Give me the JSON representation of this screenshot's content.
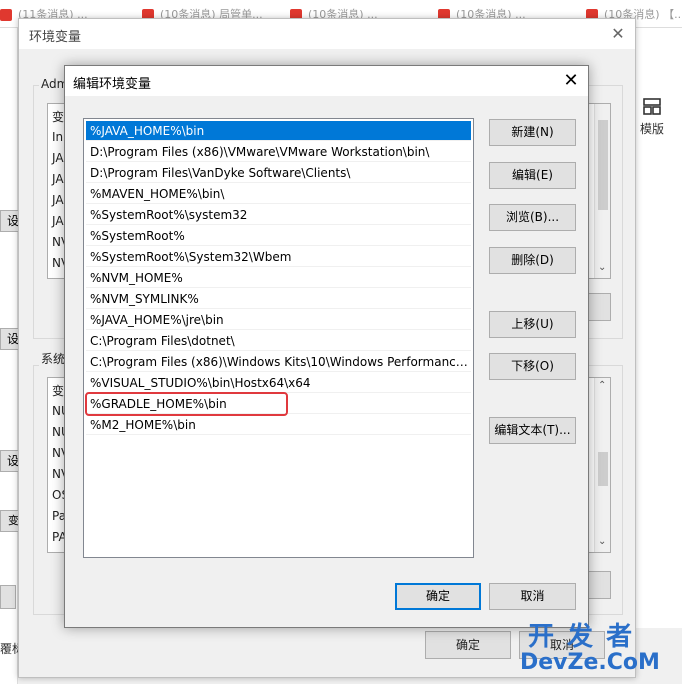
{
  "browser_tabs": [
    {
      "label": "(11条消息) ..."
    },
    {
      "label": "(10条消息) 局管单..."
    },
    {
      "label": "(10条消息) ..."
    },
    {
      "label": "(10条消息) ..."
    },
    {
      "label": "(10条消息) 【..."
    }
  ],
  "env_window": {
    "title": "环境变量",
    "user_group_label": "Adm",
    "user_list_header": "变",
    "user_list_items": [
      "In",
      "JA",
      "JA",
      "JA",
      "JA",
      "NV",
      "NV"
    ],
    "system_group_label": "系统",
    "system_list_header": "变",
    "system_list_items": [
      "NU",
      "NU",
      "NV",
      "NV",
      "OS",
      "Pa",
      "PA"
    ],
    "left_buttons": [
      "设",
      "设",
      "设",
      "变量"
    ],
    "bottom_left_text": "覆标",
    "ok_label": "确定",
    "cancel_label": "取消",
    "template_label": "模版"
  },
  "dialog": {
    "title": "编辑环境变量",
    "paths": [
      "%JAVA_HOME%\\bin",
      "D:\\Program Files (x86)\\VMware\\VMware Workstation\\bin\\",
      "D:\\Program Files\\VanDyke Software\\Clients\\",
      "%MAVEN_HOME%\\bin\\",
      "%SystemRoot%\\system32",
      "%SystemRoot%",
      "%SystemRoot%\\System32\\Wbem",
      "%NVM_HOME%",
      "%NVM_SYMLINK%",
      "%JAVA_HOME%\\jre\\bin",
      "C:\\Program Files\\dotnet\\",
      "C:\\Program Files (x86)\\Windows Kits\\10\\Windows Performance ...",
      "%VISUAL_STUDIO%\\bin\\Hostx64\\x64",
      "%GRADLE_HOME%\\bin",
      "%M2_HOME%\\bin"
    ],
    "selected_index": 0,
    "highlighted_index": 13,
    "buttons": {
      "new": "新建(N)",
      "edit": "编辑(E)",
      "browse": "浏览(B)...",
      "delete": "删除(D)",
      "move_up": "上移(U)",
      "move_down": "下移(O)",
      "edit_text": "编辑文本(T)..."
    },
    "ok_label": "确定",
    "cancel_label": "取消"
  },
  "watermark": {
    "line1": "开 发 者",
    "line2": "DevZe.CoM"
  }
}
